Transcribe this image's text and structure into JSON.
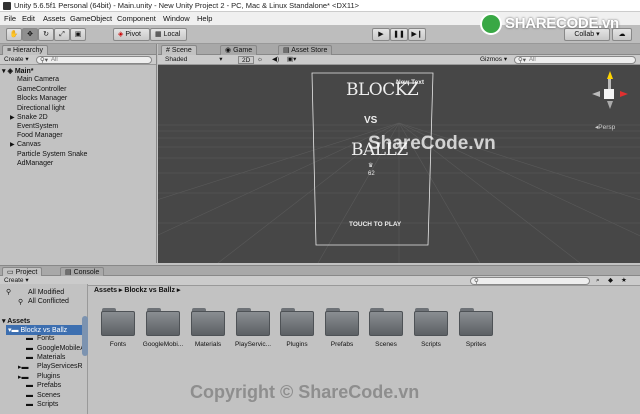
{
  "window": {
    "title": "Unity 5.6.5f1 Personal (64bit) - Main.unity - New Unity Project 2 - PC, Mac & Linux Standalone* <DX11>"
  },
  "menu": [
    "File",
    "Edit",
    "Assets",
    "GameObject",
    "Component",
    "Window",
    "Help"
  ],
  "toolbar": {
    "pivot": "Pivot",
    "local": "Local",
    "collab": "Collab",
    "collab_arrow": "▾"
  },
  "hierarchy": {
    "tab": "Hierarchy",
    "create": "Create ▾",
    "search_placeholder": "All",
    "scene": "Main*",
    "items": [
      "Main Camera",
      "GameController",
      "Blocks Manager",
      "Directional light",
      "Snake 2D",
      "EventSystem",
      "Food Manager",
      "Canvas",
      "Particle System Snake",
      "AdManager"
    ]
  },
  "scene_tabs": {
    "scene": "Scene",
    "game": "Game",
    "asset_store": "Asset Store"
  },
  "scene_bar": {
    "shaded": "Shaded",
    "twod": "2D",
    "gizmos": "Gizmos",
    "persp": "Persp",
    "search_placeholder": "All"
  },
  "game": {
    "title1": "BLOCKZ",
    "new_text": "New Text",
    "vs": "VS",
    "title2": "BALLZ",
    "score": "62",
    "touch": "TOUCH TO PLAY"
  },
  "project": {
    "tab": "Project",
    "console": "Console",
    "create": "Create ▾",
    "tree": [
      "All Modified",
      "All Conflicted",
      "Assets",
      "Blockz vs Ballz",
      "Fonts",
      "GoogleMobileA",
      "Materials",
      "PlayServicesR",
      "Plugins",
      "Prefabs",
      "Scenes",
      "Scripts"
    ],
    "breadcrumb": [
      "Assets",
      "Blockz vs Ballz"
    ],
    "folders": [
      "Fonts",
      "GoogleMobi...",
      "Materials",
      "PlayServic...",
      "Plugins",
      "Prefabs",
      "Scenes",
      "Scripts",
      "Sprites"
    ]
  },
  "watermark": {
    "logo": "SHARECODE.vn",
    "center": "ShareCode.vn",
    "copyright": "Copyright © ShareCode.vn"
  }
}
